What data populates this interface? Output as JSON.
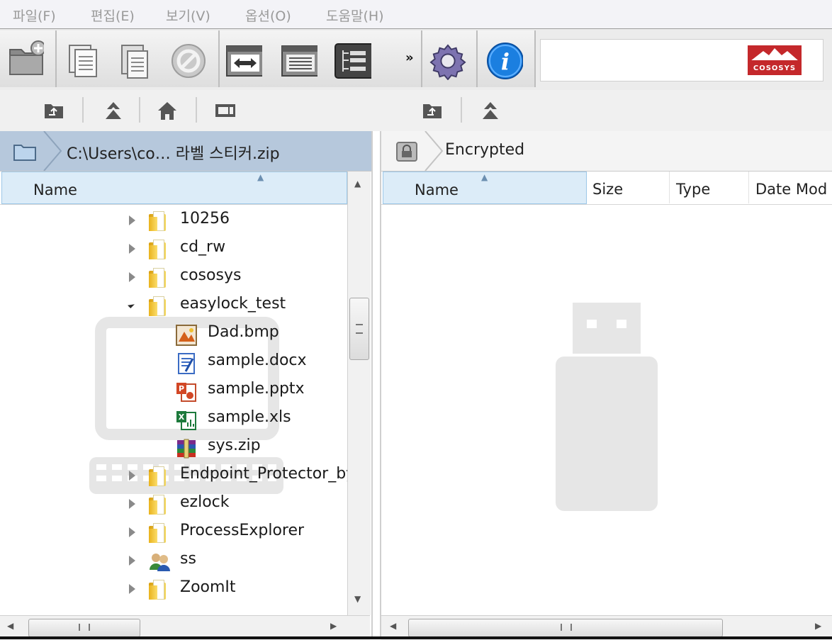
{
  "menu": {
    "items": [
      "파일(F)",
      "편집(E)",
      "보기(V)",
      "옵션(O)",
      "도움말(H)"
    ]
  },
  "toolbar": {
    "buttons": [
      "new-folder-icon",
      "copy-icon",
      "paste-icon",
      "disable-icon",
      "sync-icon",
      "list-view-icon",
      "details-view-icon",
      "more-icon",
      "settings-icon",
      "info-icon"
    ],
    "overflow_label": "»",
    "brand_text": "COSOSYS",
    "brand_color": "#c4282b"
  },
  "left_pane": {
    "path": "C:\\Users\\co… 라벨 스티커.zip",
    "column_name": "Name",
    "tree": [
      {
        "label": "10256",
        "kind": "folder",
        "state": "closed",
        "level": 0
      },
      {
        "label": "cd_rw",
        "kind": "folder",
        "state": "closed",
        "level": 0
      },
      {
        "label": "cososys",
        "kind": "folder",
        "state": "closed",
        "level": 0
      },
      {
        "label": "easylock_test",
        "kind": "folder",
        "state": "open",
        "level": 0
      },
      {
        "label": "Dad.bmp",
        "kind": "bmp",
        "level": 1
      },
      {
        "label": "sample.docx",
        "kind": "docx",
        "level": 1
      },
      {
        "label": "sample.pptx",
        "kind": "pptx",
        "level": 1
      },
      {
        "label": "sample.xls",
        "kind": "xls",
        "level": 1
      },
      {
        "label": "sys.zip",
        "kind": "zip",
        "level": 1
      },
      {
        "label": "Endpoint_Protector_by",
        "kind": "folder",
        "state": "closed",
        "level": 0
      },
      {
        "label": "ezlock",
        "kind": "folder",
        "state": "closed",
        "level": 0
      },
      {
        "label": "ProcessExplorer",
        "kind": "folder",
        "state": "closed",
        "level": 0
      },
      {
        "label": "ss",
        "kind": "users",
        "state": "closed",
        "level": 0
      },
      {
        "label": "ZoomIt",
        "kind": "folder",
        "state": "closed",
        "level": 0
      }
    ]
  },
  "right_pane": {
    "path": "Encrypted",
    "columns": [
      "Name",
      "Size",
      "Type",
      "Date Mod"
    ]
  },
  "colors": {
    "path_bar_left": "#b6c8dc",
    "header_selected": "#dcecf8",
    "info_blue": "#1b7fe0"
  }
}
